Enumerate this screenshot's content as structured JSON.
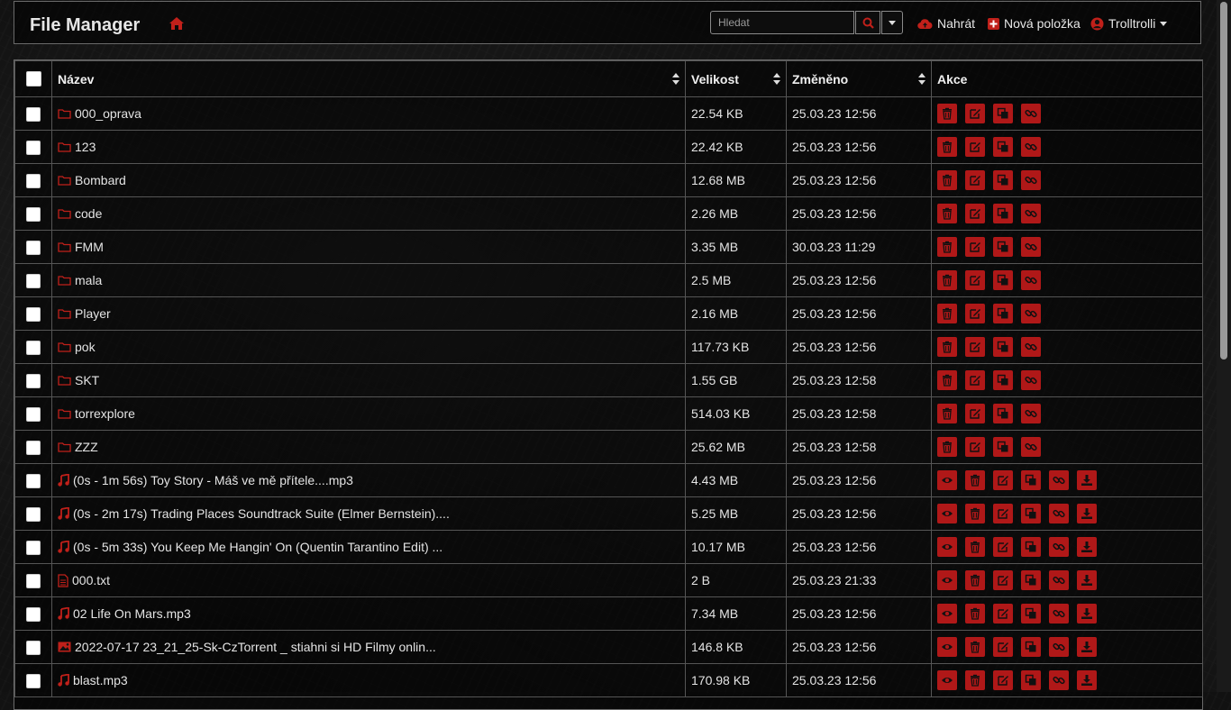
{
  "app": {
    "title": "File Manager"
  },
  "nav": {
    "search_placeholder": "Hledat",
    "upload_label": "Nahrát",
    "new_item_label": "Nová položka",
    "user_label": "Trolltrolli"
  },
  "colors": {
    "accent": "#c0201a",
    "background": "#111111"
  },
  "table": {
    "columns": [
      "Název",
      "Velikost",
      "Změněno",
      "Akce"
    ],
    "rows": [
      {
        "name": "000_oprava",
        "size": "22.54 KB",
        "modified": "25.03.23 12:56",
        "icon": "folder-icon",
        "kind": "folder"
      },
      {
        "name": "123",
        "size": "22.42 KB",
        "modified": "25.03.23 12:56",
        "icon": "folder-icon",
        "kind": "folder"
      },
      {
        "name": "Bombard",
        "size": "12.68 MB",
        "modified": "25.03.23 12:56",
        "icon": "folder-icon",
        "kind": "folder"
      },
      {
        "name": "code",
        "size": "2.26 MB",
        "modified": "25.03.23 12:56",
        "icon": "folder-icon",
        "kind": "folder"
      },
      {
        "name": "FMM",
        "size": "3.35 MB",
        "modified": "30.03.23 11:29",
        "icon": "folder-icon",
        "kind": "folder"
      },
      {
        "name": "mala",
        "size": "2.5 MB",
        "modified": "25.03.23 12:56",
        "icon": "folder-icon",
        "kind": "folder"
      },
      {
        "name": "Player",
        "size": "2.16 MB",
        "modified": "25.03.23 12:56",
        "icon": "folder-icon",
        "kind": "folder"
      },
      {
        "name": "pok",
        "size": "117.73 KB",
        "modified": "25.03.23 12:56",
        "icon": "folder-icon",
        "kind": "folder"
      },
      {
        "name": "SKT",
        "size": "1.55 GB",
        "modified": "25.03.23 12:58",
        "icon": "folder-icon",
        "kind": "folder"
      },
      {
        "name": "torrexplore",
        "size": "514.03 KB",
        "modified": "25.03.23 12:58",
        "icon": "folder-icon",
        "kind": "folder"
      },
      {
        "name": "ZZZ",
        "size": "25.62 MB",
        "modified": "25.03.23 12:58",
        "icon": "folder-icon",
        "kind": "folder"
      },
      {
        "name": "(0s - 1m 56s) Toy Story - Máš ve mě přítele....mp3",
        "size": "4.43 MB",
        "modified": "25.03.23 12:56",
        "icon": "music-icon",
        "kind": "file"
      },
      {
        "name": "(0s - 2m 17s) Trading Places Soundtrack Suite (Elmer Bernstein)....",
        "size": "5.25 MB",
        "modified": "25.03.23 12:56",
        "icon": "music-icon",
        "kind": "file"
      },
      {
        "name": "(0s - 5m 33s) You Keep Me Hangin' On (Quentin Tarantino Edit) ...",
        "size": "10.17 MB",
        "modified": "25.03.23 12:56",
        "icon": "music-icon",
        "kind": "file"
      },
      {
        "name": "000.txt",
        "size": "2 B",
        "modified": "25.03.23 21:33",
        "icon": "text-file-icon",
        "kind": "file"
      },
      {
        "name": "02 Life On Mars.mp3",
        "size": "7.34 MB",
        "modified": "25.03.23 12:56",
        "icon": "music-icon",
        "kind": "file"
      },
      {
        "name": "2022-07-17 23_21_25-Sk-CzTorrent _ stiahni si HD Filmy onlin...",
        "size": "146.8 KB",
        "modified": "25.03.23 12:56",
        "icon": "image-icon",
        "kind": "file"
      },
      {
        "name": "blast.mp3",
        "size": "170.98 KB",
        "modified": "25.03.23 12:56",
        "icon": "music-icon",
        "kind": "file"
      }
    ]
  }
}
